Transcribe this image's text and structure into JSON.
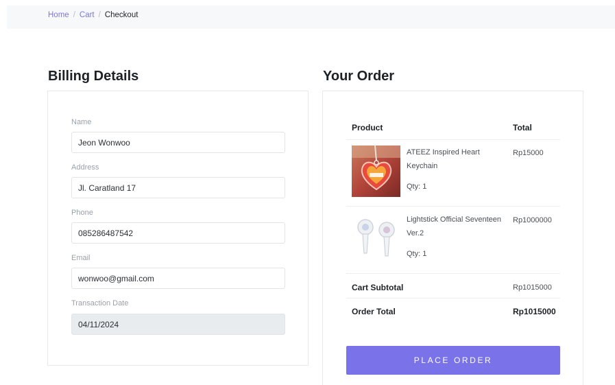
{
  "breadcrumb": {
    "items": [
      "Home",
      "Cart"
    ],
    "current": "Checkout",
    "separator": "/"
  },
  "billing": {
    "title": "Billing Details",
    "fields": [
      {
        "label": "Name",
        "value": "Jeon Wonwoo"
      },
      {
        "label": "Address",
        "value": "Jl. Caratland 17"
      },
      {
        "label": "Phone",
        "value": "085286487542"
      },
      {
        "label": "Email",
        "value": "wonwoo@gmail.com"
      },
      {
        "label": "Transaction Date",
        "value": "04/11/2024"
      }
    ]
  },
  "order": {
    "title": "Your Order",
    "columns": {
      "product": "Product",
      "total": "Total"
    },
    "items": [
      {
        "name": "ATEEZ Inspired Heart Keychain",
        "qty": "Qty: 1",
        "price": "Rp15000",
        "image": "heart-keychain-photo"
      },
      {
        "name": "Lightstick Official Seventeen Ver.2",
        "qty": "Qty: 1",
        "price": "Rp1000000",
        "image": "lightstick-photo"
      }
    ],
    "subtotal_label": "Cart Subtotal",
    "subtotal_value": "Rp1015000",
    "total_label": "Order Total",
    "total_value": "Rp1015000",
    "place_order": "PLACE ORDER"
  },
  "colors": {
    "accent": "#7a72e8",
    "link": "#7b75e8",
    "disabled_bg": "#e9ecef"
  }
}
